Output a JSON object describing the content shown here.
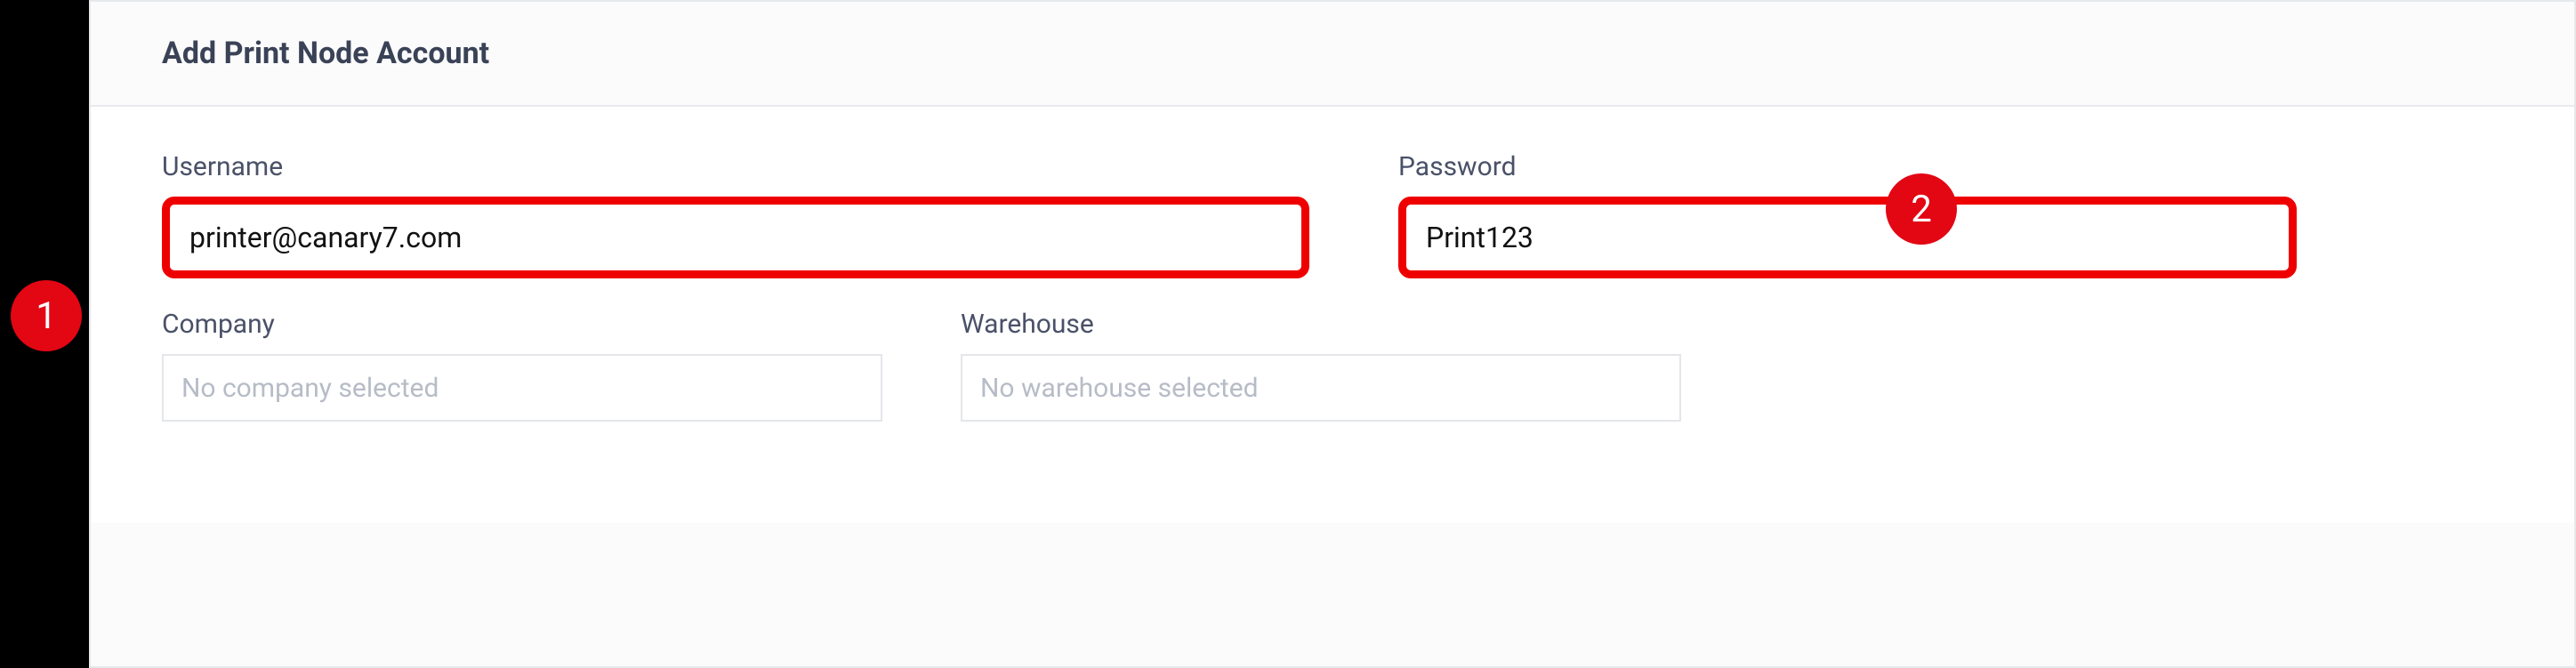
{
  "header": {
    "title": "Add Print Node Account"
  },
  "fields": {
    "username": {
      "label": "Username",
      "value": "printer@canary7.com"
    },
    "password": {
      "label": "Password",
      "value": "Print123"
    },
    "company": {
      "label": "Company",
      "placeholder": "No company selected"
    },
    "warehouse": {
      "label": "Warehouse",
      "placeholder": "No warehouse selected"
    }
  },
  "annotations": {
    "badge1": "1",
    "badge2": "2"
  }
}
